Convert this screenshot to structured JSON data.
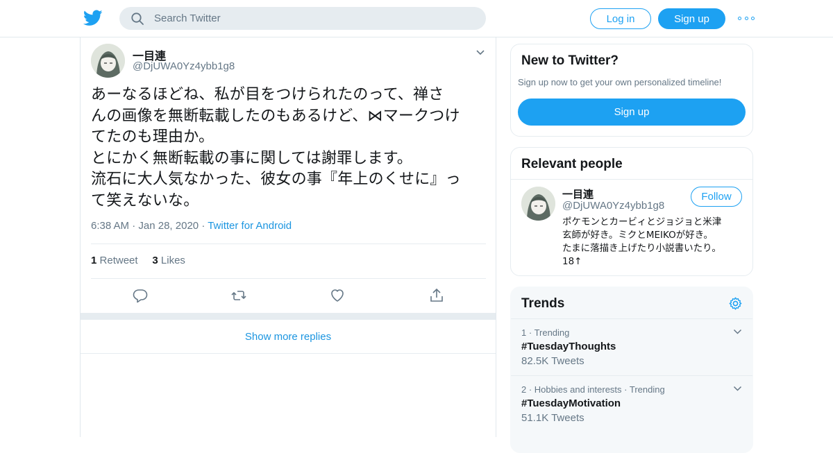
{
  "header": {
    "search_placeholder": "Search Twitter",
    "login_label": "Log in",
    "signup_label": "Sign up",
    "brand_color": "#1da1f2"
  },
  "tweet": {
    "author_name": "一目連",
    "author_handle": "@DjUWA0Yz4ybb1g8",
    "text": "あーなるほどね、私が目をつけられたのって、禅さ\nんの画像を無断転載したのもあるけど、⋈マークつけ\nてたのも理由か。\nとにかく無断転載の事に関しては謝罪します。\n流石に大人気なかった、彼女の事『年上のくせに』っ\nて笑えないな。",
    "time": "6:38 AM",
    "date": "Jan 28, 2020",
    "source": "Twitter for Android",
    "retweet_count": "1",
    "retweet_label": "Retweet",
    "like_count": "3",
    "like_label": "Likes",
    "show_more": "Show more replies"
  },
  "sidebar": {
    "new_to_twitter": {
      "title": "New to Twitter?",
      "subtitle": "Sign up now to get your own personalized timeline!",
      "button": "Sign up"
    },
    "relevant_people": {
      "title": "Relevant people",
      "name": "一目連",
      "handle": "@DjUWA0Yz4ybb1g8",
      "follow_label": "Follow",
      "bio": "ポケモンとカービィとジョジョと米津\n玄師が好き。ミクとMEIKOが好き。\nたまに落描き上げたり小説書いたり。\n18↑"
    },
    "trends": {
      "title": "Trends",
      "items": [
        {
          "rank": "1",
          "context": "Trending",
          "tag": "#TuesdayThoughts",
          "count": "82.5K Tweets"
        },
        {
          "rank": "2",
          "context": "Hobbies and interests · Trending",
          "tag": "#TuesdayMotivation",
          "count": "51.1K Tweets"
        }
      ]
    }
  }
}
